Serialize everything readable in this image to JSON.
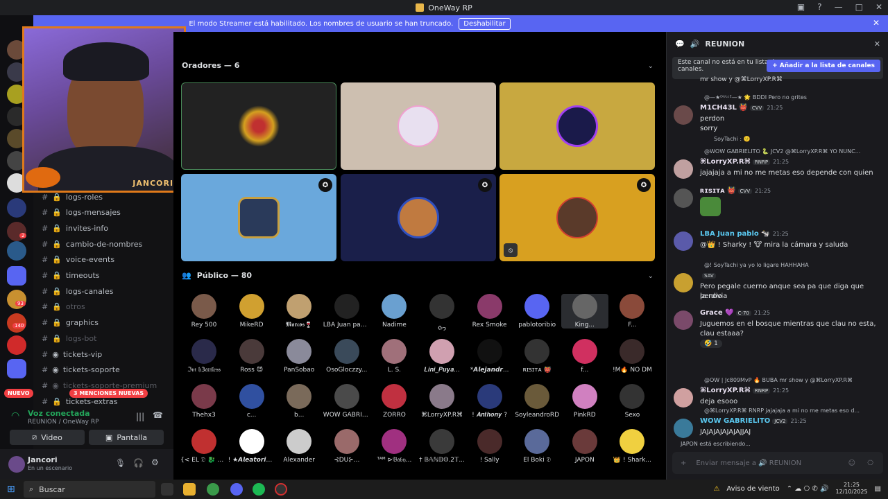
{
  "window": {
    "title": "OneWay RP"
  },
  "banner": {
    "text": "El modo Streamer está habilitado. Los nombres de usuario se han truncado.",
    "button": "Deshabilitar"
  },
  "webcam": {
    "name": "JANCORIS"
  },
  "channels": [
    {
      "label": "logs-roles",
      "dim": false
    },
    {
      "label": "logs-mensajes",
      "dim": false
    },
    {
      "label": "invites-info",
      "dim": false
    },
    {
      "label": "cambio-de-nombres",
      "dim": false
    },
    {
      "label": "voice-events",
      "dim": false
    },
    {
      "label": "timeouts",
      "dim": false
    },
    {
      "label": "logs-canales",
      "dim": false
    },
    {
      "label": "otros",
      "dim": true
    },
    {
      "label": "graphics",
      "dim": false
    },
    {
      "label": "logs-bot",
      "dim": true
    },
    {
      "label": "tickets-vip",
      "dim": false
    },
    {
      "label": "tickets-soporte",
      "dim": false
    },
    {
      "label": "tickets-soporte-premium",
      "dim": true
    },
    {
      "label": "tickets-extras",
      "dim": false
    }
  ],
  "badges": {
    "nuevo": "NUEVO",
    "menciones": "3 MENCIONES NUEVAS",
    "b93": "93",
    "b140": "140",
    "b2": "2"
  },
  "voice": {
    "status": "Voz conectada",
    "channel": "REUNION",
    "server": "/ OneWay RP",
    "video": "Video",
    "screen": "Pantalla"
  },
  "user": {
    "name": "Jancori",
    "status": "En un escenario"
  },
  "stage": {
    "speakers_label": "Oradores — 6",
    "public_label": "Público — 80",
    "audience": [
      [
        "Rey 500",
        "MikeRD",
        "𝕸𝖆𝖗𝖈𝖔𝖘🍷",
        "LBA Juan pab...",
        "Nadime",
        "ᡣ𐭩",
        "Rex Smoke",
        "pablotoribio",
        "King...",
        "F..."
      ],
      [
        "ℑ𝔪 𝔥3𝔞𝔯𝔱𝔩𝔢𝔰𝔰",
        "Ross 😈",
        "PanSobao",
        "OsoGloczzy...",
        "L. S.",
        "𝑳𝒊𝒏𝒊_𝑷𝒖𝒚𝒂...",
        "*𝘼𝙡𝙚𝙟𝙖𝙣𝙙𝙧...",
        "ʀɪꜱɪᴛᴀ 👹",
        "f...",
        "!M🔥 NO DM"
      ],
      [
        "Thehx3",
        "c...",
        "b...",
        "WOW GABRIE...",
        "ZORRO",
        "⌘LorryⅩP.R⌘",
        "! 𝑨𝒏𝒕𝒉𝒐𝒏𝒚 ?",
        "SoyleandroRD",
        "PinkRD",
        "Sexo"
      ],
      [
        "{< EL 𝔇 🐉 BO...",
        "! ★𝘼𝙡𝙚𝙖𝙩𝙤𝙧𝙞𝙖...",
        "Alexander",
        "⊰DU⊱...",
        "ᵀᴬᴹ ⊳𝔅𝔞𝔟𝔶...",
        "† 𝔹𝔸ℕ𝔻𝕆.2𝕋...",
        "! Sally",
        "El Boki 𝔇",
        "JAPON",
        "👑 ! Shark..."
      ]
    ]
  },
  "chat": {
    "channel": "REUNION",
    "notice": "Este canal no está en tu lista de canales.",
    "add_button": "+ Añadir a la lista de canales",
    "placeholder": "Enviar mensaje a 🔊 REUNION",
    "typing": "JAPON está escribiendo...",
    "top_line": "mr show y @⌘LorryⅩP.R⌘",
    "messages": [
      {
        "reply": "@—★ᴰᵁᴸᶜᴱ—★ 🌟 BDDI  Pero no grites",
        "name": "M1CH43L 👹",
        "tag": "CVV",
        "time": "21:25",
        "lines": [
          "perdon",
          "sorry"
        ],
        "extra": "SoyTachi : 🙂"
      },
      {
        "reply": "@WOW GABRIELITO 🐍 JCV2  @⌘LorryⅩP.R⌘ YO NUNC...",
        "name": "⌘LorryⅩP.R⌘",
        "tag": "RNRP",
        "time": "21:25",
        "lines": [
          "jajajaja a mi no me metas eso depende con quien"
        ]
      },
      {
        "name": "ʀɪꜱɪᴛᴀ 👹",
        "tag": "CVV",
        "time": "21:25",
        "lines": [
          ""
        ]
      },
      {
        "name": "LBA Juan pablo 🐄",
        "time": "21:25",
        "lines": [
          "@👑 ! Sharky ! 🐮  mira la cámara y saluda"
        ]
      },
      {
        "reply": "@!  SoyTachi ya yo lo ligare HAHHAHA",
        "name": "",
        "tag": "SAV",
        "time": "",
        "lines": [
          "Pero pegale cuerno anque sea pa que diga que perdio",
          "la novia"
        ]
      },
      {
        "name": "Grace 💜",
        "tag": "C-70",
        "time": "21:25",
        "lines": [
          "Juguemos en el bosque mientras que clau no esta,",
          "clau estaaa?"
        ],
        "reaction": "1"
      },
      {
        "reply": "@OW | Jc809MvP 🔥 BUBA  mr show y @⌘LorryⅩP.R⌘",
        "name": "⌘LorryⅩP.R⌘",
        "tag": "RNRP",
        "time": "21:25",
        "lines": [
          "deja esooo"
        ]
      },
      {
        "reply": "@⌘LorryⅩP.R⌘  RNRP  jajajaja a mi no me metas eso d...",
        "name": "WOW GABRIELITO",
        "tag": "JCV2",
        "time": "21:25",
        "lines": [
          "JAJAJAJAJAJAJJAJ"
        ]
      }
    ]
  },
  "taskbar": {
    "search": "Buscar",
    "weather": "Aviso de viento",
    "time": "21:25",
    "date": "12/10/2025"
  }
}
